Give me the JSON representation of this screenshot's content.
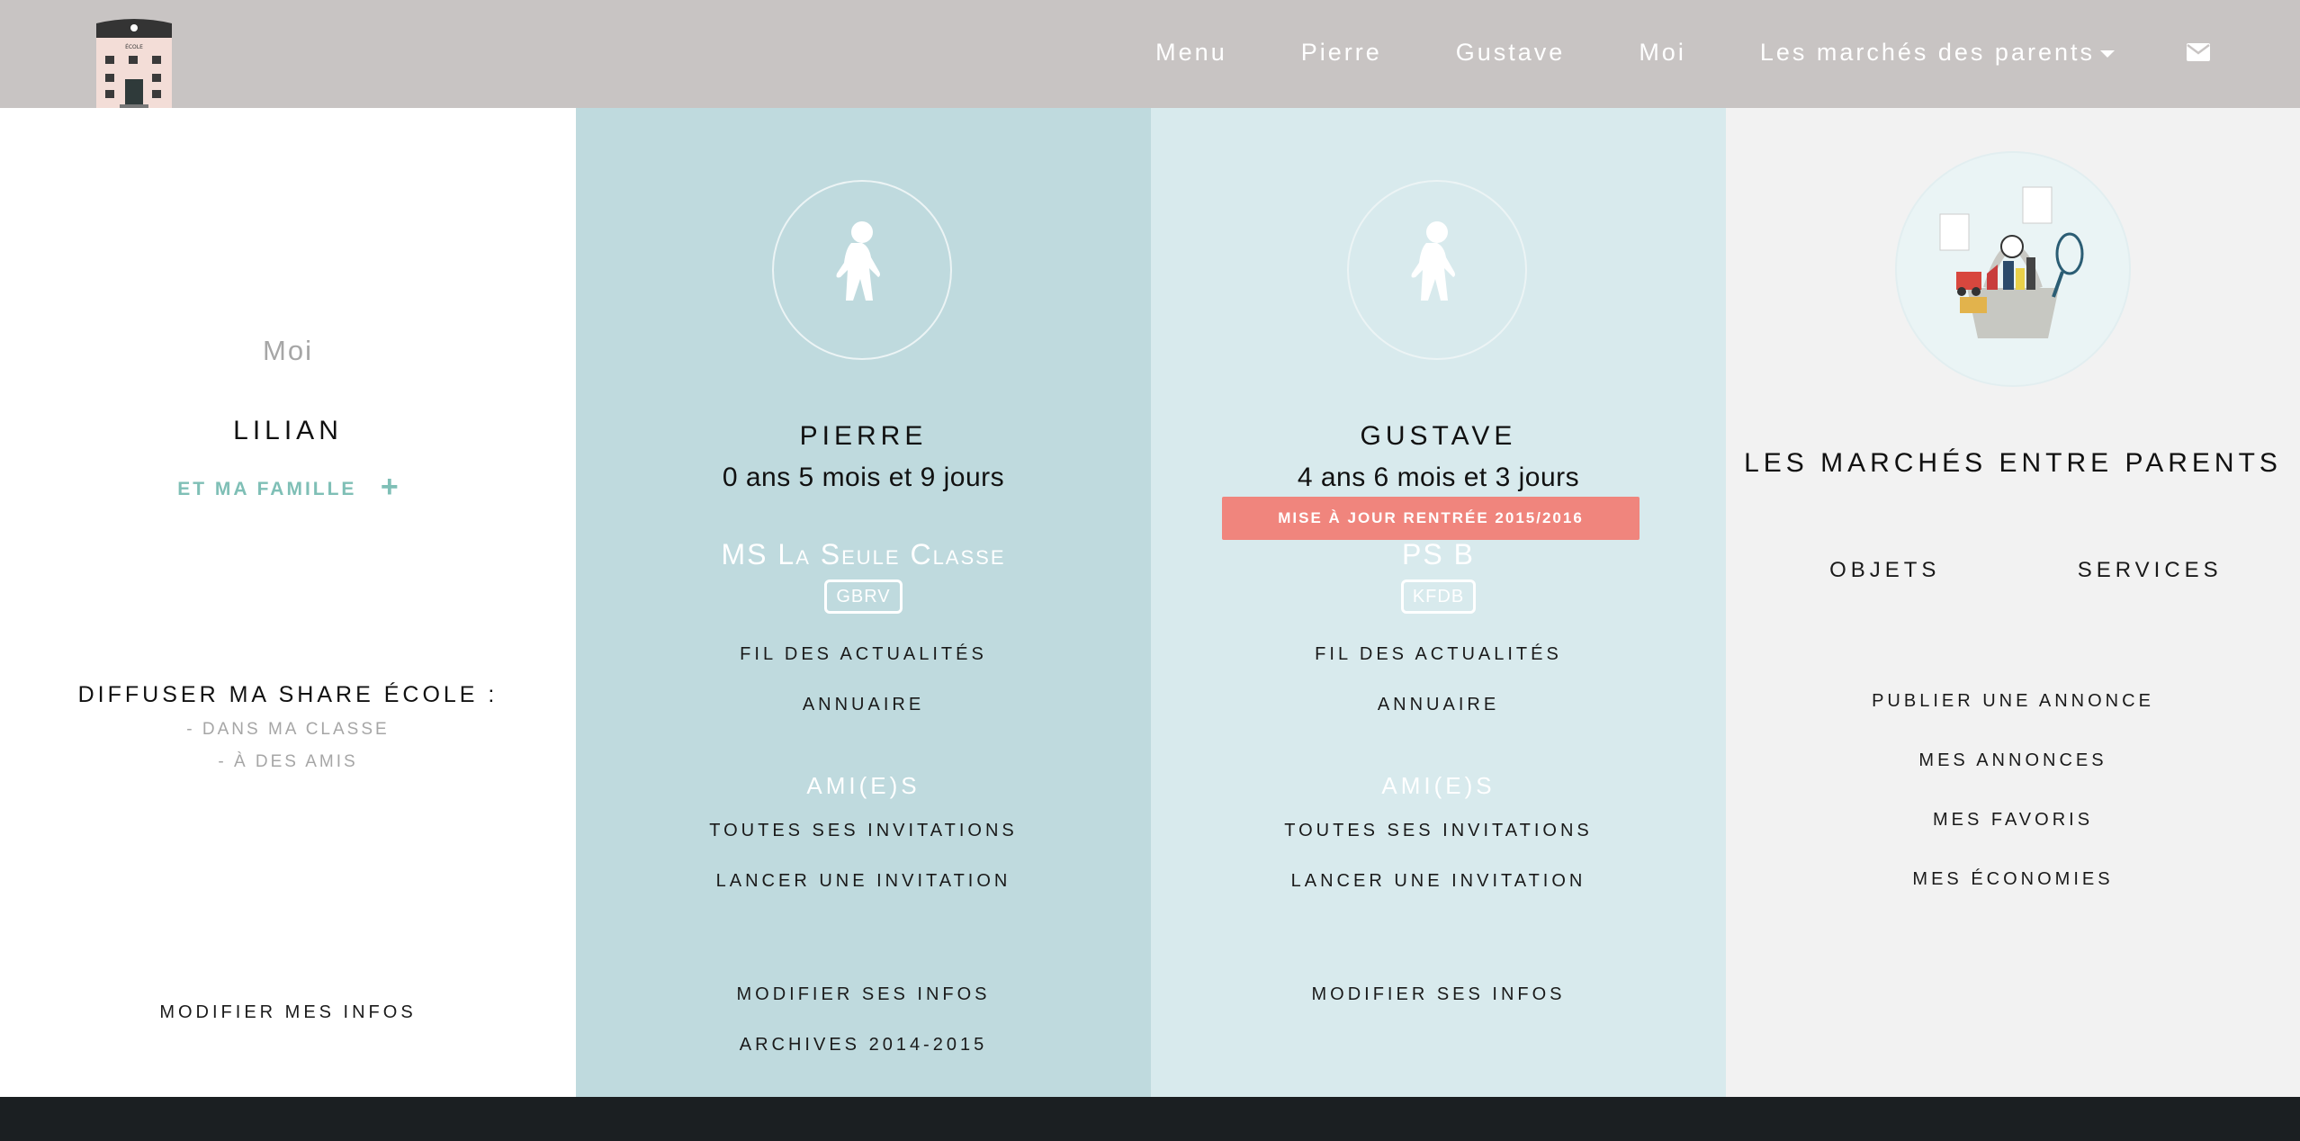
{
  "nav": {
    "items": [
      "Menu",
      "Pierre",
      "Gustave",
      "Moi",
      "Les marchés des parents"
    ],
    "logo_text": "ÉCOLE"
  },
  "me": {
    "heading": "Moi",
    "name": "LILIAN",
    "family_link": "ET MA FAMILLE",
    "share_title": "DIFFUSER MA SHARE ÉCOLE :",
    "share_class": "- DANS MA CLASSE",
    "share_friends": "- À DES AMIS",
    "edit": "MODIFIER MES INFOS"
  },
  "children": [
    {
      "name": "PIERRE",
      "age": "0 ans 5 mois et 9 jours",
      "class": "MS La Seule Classe",
      "code": "GBRV",
      "news": "FIL DES ACTUALITÉS",
      "directory": "ANNUAIRE",
      "friends": "AMI(E)S",
      "invitations": "TOUTES SES INVITATIONS",
      "invite": "LANCER UNE INVITATION",
      "edit": "MODIFIER SES INFOS",
      "archives": "ARCHIVES 2014-2015"
    },
    {
      "name": "GUSTAVE",
      "age": "4 ans 6 mois et 3 jours",
      "update_badge": "MISE À JOUR RENTRÉE 2015/2016",
      "class": "PS B",
      "code": "KFDB",
      "news": "FIL DES ACTUALITÉS",
      "directory": "ANNUAIRE",
      "friends": "AMI(E)S",
      "invitations": "TOUTES SES INVITATIONS",
      "invite": "LANCER UNE INVITATION",
      "edit": "MODIFIER SES INFOS"
    }
  ],
  "market": {
    "title": "LES MARCHÉS ENTRE PARENTS",
    "tab_objects": "OBJETS",
    "tab_services": "SERVICES",
    "publish": "PUBLIER UNE ANNONCE",
    "my_ads": "MES ANNONCES",
    "favorites": "MES FAVORIS",
    "savings": "MES ÉCONOMIES"
  },
  "colors": {
    "navbar": "#c8c4c3",
    "accent_teal": "#7fbfb6",
    "child1_bg": "#bfdade",
    "child2_bg": "#d8eaed",
    "market_bg": "#f2f2f2",
    "badge": "#f0857d",
    "footer": "#1b1f22"
  },
  "icons": [
    "school-logo",
    "envelope-icon",
    "child-silhouette-icon",
    "plus-icon",
    "market-basket-illustration"
  ]
}
